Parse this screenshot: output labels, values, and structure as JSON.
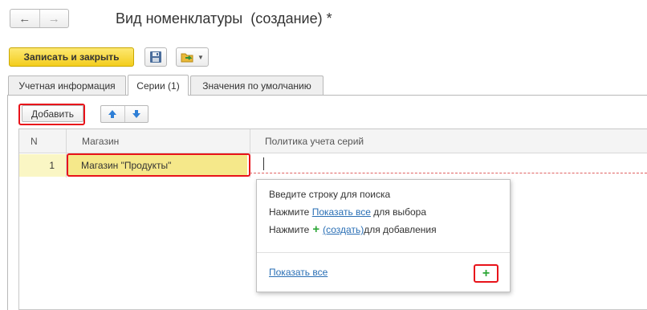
{
  "window": {
    "title": "Вид номенклатуры  (создание) *"
  },
  "nav": {
    "back_icon": "←",
    "forward_icon": "→"
  },
  "toolbar": {
    "save_close_label": "Записать и закрыть",
    "save_icon": "floppy-disk-icon",
    "more_icon": "folder-arrow-icon"
  },
  "tabs": [
    {
      "label": "Учетная информация",
      "active": false
    },
    {
      "label": "Серии (1)",
      "active": true
    },
    {
      "label": "Значения по умолчанию",
      "active": false
    }
  ],
  "table_toolbar": {
    "add_label": "Добавить",
    "up_icon": "arrow-up-icon",
    "down_icon": "arrow-down-icon"
  },
  "table": {
    "columns": [
      "N",
      "Магазин",
      "Политика учета серий"
    ],
    "rows": [
      {
        "n": "1",
        "shop": "Магазин \"Продукты\"",
        "policy": ""
      }
    ]
  },
  "popup": {
    "line1": "Введите строку для поиска",
    "line2_prefix": "Нажмите ",
    "line2_link": "Показать все",
    "line2_suffix": " для выбора",
    "line3_prefix": "Нажмите",
    "line3_plus": "+",
    "line3_link": "(создать)",
    "line3_suffix": " для добавления",
    "show_all": "Показать все",
    "create_plus": "+"
  },
  "colors": {
    "accent_yellow": "#f3cd1c",
    "highlight_red": "#e8131a",
    "link_blue": "#2a6fb5",
    "plus_green": "#2da737",
    "row_selected": "#f5e88a"
  }
}
